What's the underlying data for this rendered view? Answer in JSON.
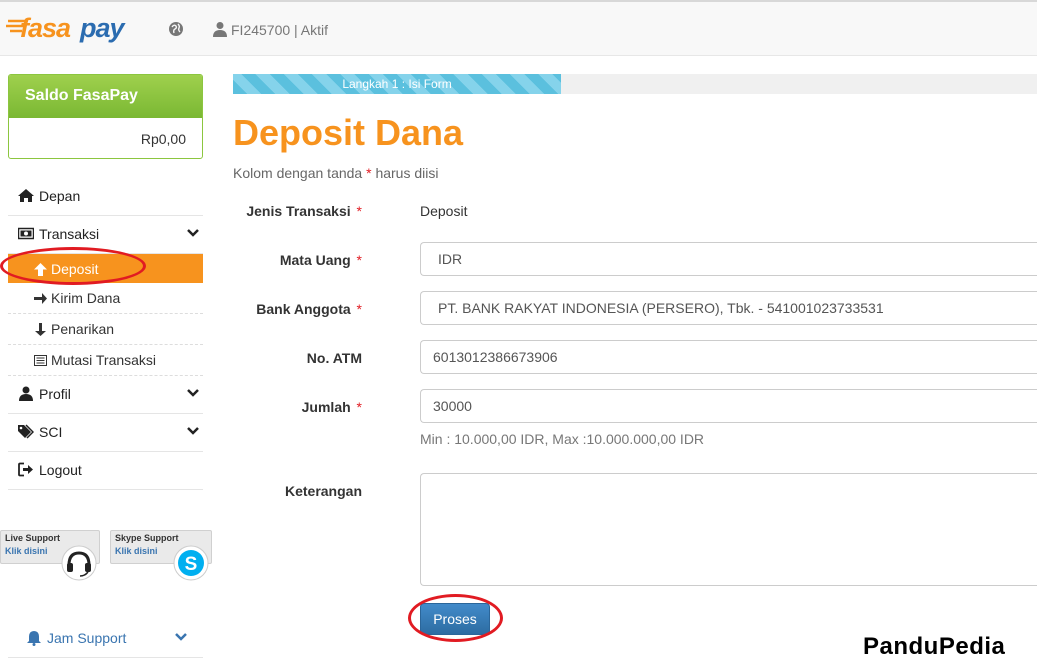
{
  "header": {
    "logo_text": "fasapay",
    "account_text": "FI245700 | Aktif",
    "colors": {
      "logo_orange": "#f7931e",
      "logo_blue": "#2b6cb0"
    }
  },
  "sidebar": {
    "saldo_title": "Saldo FasaPay",
    "saldo_value": "Rp0,00",
    "items": [
      {
        "label": "Depan",
        "icon": "home-icon"
      },
      {
        "label": "Transaksi",
        "icon": "money-icon",
        "expanded": true,
        "children": [
          {
            "label": "Deposit",
            "icon": "arrow-up-icon",
            "active": true
          },
          {
            "label": "Kirim Dana",
            "icon": "arrow-right-icon"
          },
          {
            "label": "Penarikan",
            "icon": "arrow-down-icon"
          },
          {
            "label": "Mutasi Transaksi",
            "icon": "list-icon"
          }
        ]
      },
      {
        "label": "Profil",
        "icon": "user-icon"
      },
      {
        "label": "SCI",
        "icon": "tags-icon"
      },
      {
        "label": "Logout",
        "icon": "logout-icon"
      }
    ],
    "live_support": {
      "title": "Live Support",
      "link": "Klik disini"
    },
    "skype_support": {
      "title": "Skype Support",
      "link": "Klik disini"
    },
    "jam_support": "Jam Support"
  },
  "main": {
    "progress_label": "Langkah 1 : Isi Form",
    "progress_value": 0.408,
    "title": "Deposit Dana",
    "required_note_prefix": "Kolom dengan tanda ",
    "required_mark": "*",
    "required_note_suffix": " harus diisi",
    "form": {
      "jenis_label": "Jenis Transaksi",
      "jenis_value": "Deposit",
      "mata_uang_label": "Mata Uang",
      "mata_uang_value": "IDR",
      "bank_label": "Bank Anggota",
      "bank_value": "PT. BANK RAKYAT INDONESIA (PERSERO), Tbk. - 541001023733531",
      "atm_label": "No. ATM",
      "atm_value": "6013012386673906",
      "jumlah_label": "Jumlah",
      "jumlah_value": "30000",
      "jumlah_hint": "Min : 10.000,00 IDR, Max :10.000.000,00 IDR",
      "keterangan_label": "Keterangan",
      "keterangan_value": "",
      "submit_label": "Proses"
    },
    "colors": {
      "accent": "#f7931e",
      "primary_button": "#428bca",
      "required": "#e11b22",
      "annotation": "#e11b22"
    }
  },
  "watermark": "PanduPedia"
}
